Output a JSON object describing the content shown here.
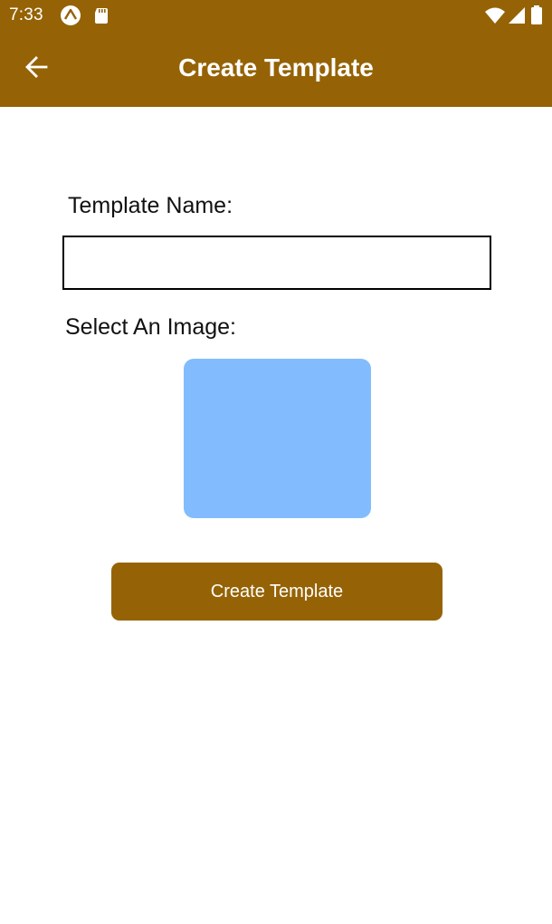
{
  "status_bar": {
    "time": "7:33",
    "left_icons": [
      "expo-icon",
      "sd-card-icon"
    ],
    "right_icons": [
      "wifi-icon",
      "signal-icon",
      "battery-icon"
    ]
  },
  "app_bar": {
    "title": "Create Template",
    "back_icon": "arrow-left-icon"
  },
  "form": {
    "name_label": "Template Name:",
    "name_value": "",
    "image_label": "Select An Image:",
    "image_placeholder_color": "#82bcff",
    "submit_label": "Create Template"
  },
  "colors": {
    "brand": "#956305",
    "image_placeholder": "#82bcff"
  }
}
